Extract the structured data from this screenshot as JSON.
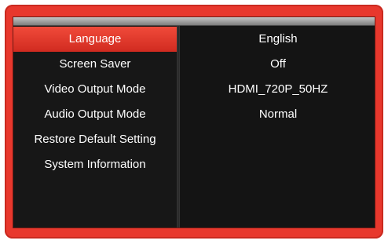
{
  "menu": {
    "items": [
      {
        "label": "Language",
        "selected": true
      },
      {
        "label": "Screen Saver",
        "selected": false
      },
      {
        "label": "Video Output Mode",
        "selected": false
      },
      {
        "label": "Audio Output Mode",
        "selected": false
      },
      {
        "label": "Restore Default Setting",
        "selected": false
      },
      {
        "label": "System Information",
        "selected": false
      }
    ]
  },
  "values": {
    "items": [
      "English",
      "Off",
      "HDMI_720P_50HZ",
      "Normal"
    ]
  },
  "colors": {
    "frame": "#e8382d",
    "selected_highlight": "#e03a2c",
    "panel_background": "#141414",
    "text": "#ffffff"
  }
}
